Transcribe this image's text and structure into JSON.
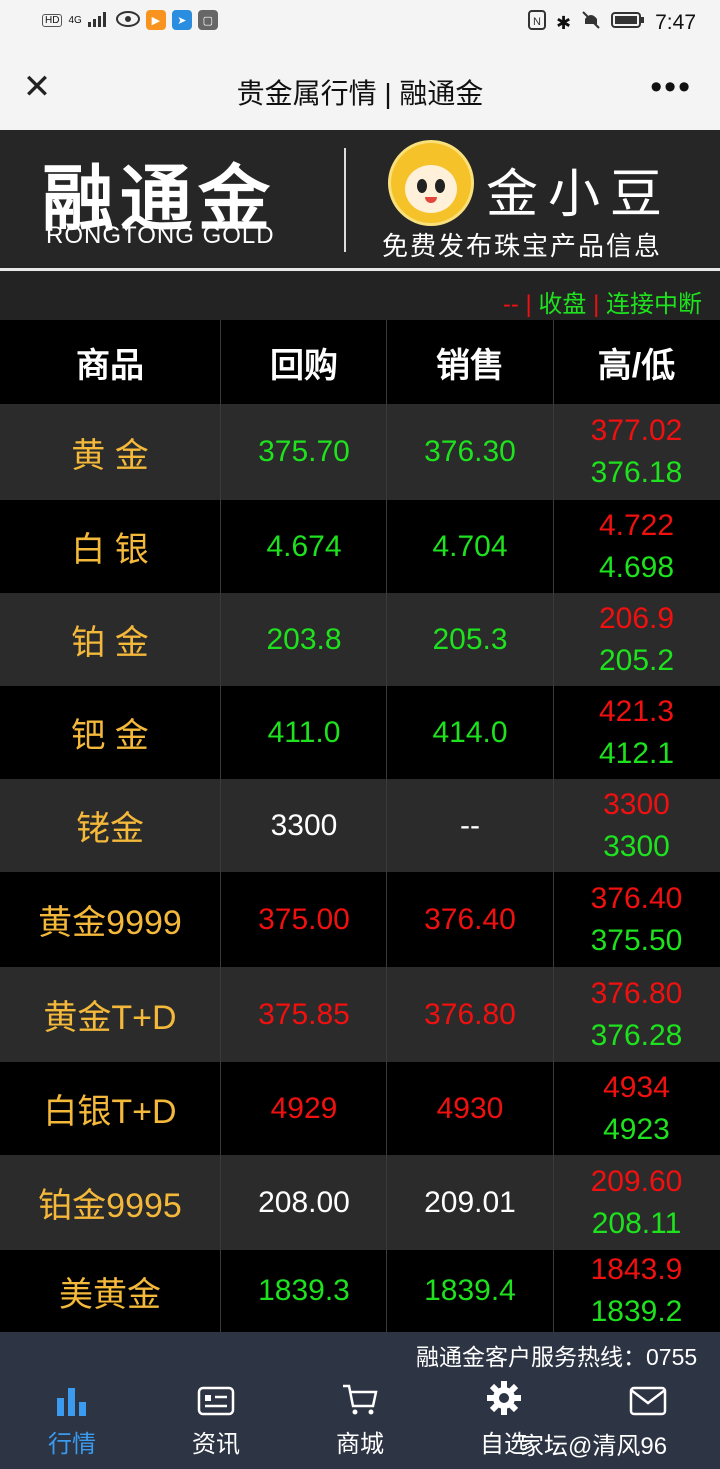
{
  "status_bar": {
    "left_icons": [
      "HD",
      "4G",
      "signal-icon",
      "eye-icon",
      "app-orange-icon",
      "app-blue-icon",
      "app-huawei-icon"
    ],
    "right_icons": [
      "nfc-icon",
      "bluetooth-icon",
      "mute-icon",
      "battery-icon"
    ],
    "time": "7:47"
  },
  "titlebar": {
    "close_glyph": "✕",
    "title": "贵金属行情 | 融通金",
    "more_glyph": "•••"
  },
  "banner": {
    "brand_cn": "融通金",
    "brand_en": "RONGTONG GOLD",
    "mascot_brand": "金小豆",
    "slogan": "免费发布珠宝产品信息"
  },
  "market_status": {
    "change": "--",
    "sep1": "|",
    "state": "收盘",
    "sep2": "|",
    "connection": "连接中断"
  },
  "table": {
    "headers": [
      "商品",
      "回购",
      "销售",
      "高/低"
    ],
    "rows": [
      {
        "name": "黄 金",
        "buy": "375.70",
        "sell": "376.30",
        "high": "377.02",
        "low": "376.18",
        "price_color": "green"
      },
      {
        "name": "白 银",
        "buy": "4.674",
        "sell": "4.704",
        "high": "4.722",
        "low": "4.698",
        "price_color": "green"
      },
      {
        "name": "铂 金",
        "buy": "203.8",
        "sell": "205.3",
        "high": "206.9",
        "low": "205.2",
        "price_color": "green"
      },
      {
        "name": "钯 金",
        "buy": "411.0",
        "sell": "414.0",
        "high": "421.3",
        "low": "412.1",
        "price_color": "green"
      },
      {
        "name": "铑金",
        "buy": "3300",
        "sell": "--",
        "high": "3300",
        "low": "3300",
        "price_color": "white"
      },
      {
        "name": "黄金9999",
        "buy": "375.00",
        "sell": "376.40",
        "high": "376.40",
        "low": "375.50",
        "price_color": "red"
      },
      {
        "name": "黄金T+D",
        "buy": "375.85",
        "sell": "376.80",
        "high": "376.80",
        "low": "376.28",
        "price_color": "red"
      },
      {
        "name": "白银T+D",
        "buy": "4929",
        "sell": "4930",
        "high": "4934",
        "low": "4923",
        "price_color": "red"
      },
      {
        "name": "铂金9995",
        "buy": "208.00",
        "sell": "209.01",
        "high": "209.60",
        "low": "208.11",
        "price_color": "white"
      },
      {
        "name": "美黄金",
        "buy": "1839.3",
        "sell": "1839.4",
        "high": "1843.9",
        "low": "1839.2",
        "price_color": "green"
      }
    ]
  },
  "hotline": "融通金客户服务热线：0755",
  "tabs": [
    {
      "label": "行情",
      "icon": "bar-chart-icon",
      "active": true
    },
    {
      "label": "资讯",
      "icon": "news-card-icon",
      "active": false
    },
    {
      "label": "商城",
      "icon": "cart-icon",
      "active": false
    },
    {
      "label": "自选",
      "icon": "gear-icon",
      "active": false
    },
    {
      "label": "",
      "icon": "mail-icon",
      "active": false
    }
  ],
  "watermark": "家坛@清风96",
  "colors": {
    "banner_bg": "#262626",
    "gold_text": "#f4b93a",
    "up_red": "#f01010",
    "down_green": "#1de21d",
    "tabbar_bg": "#2d3444",
    "active_tab": "#3a9bf0"
  }
}
